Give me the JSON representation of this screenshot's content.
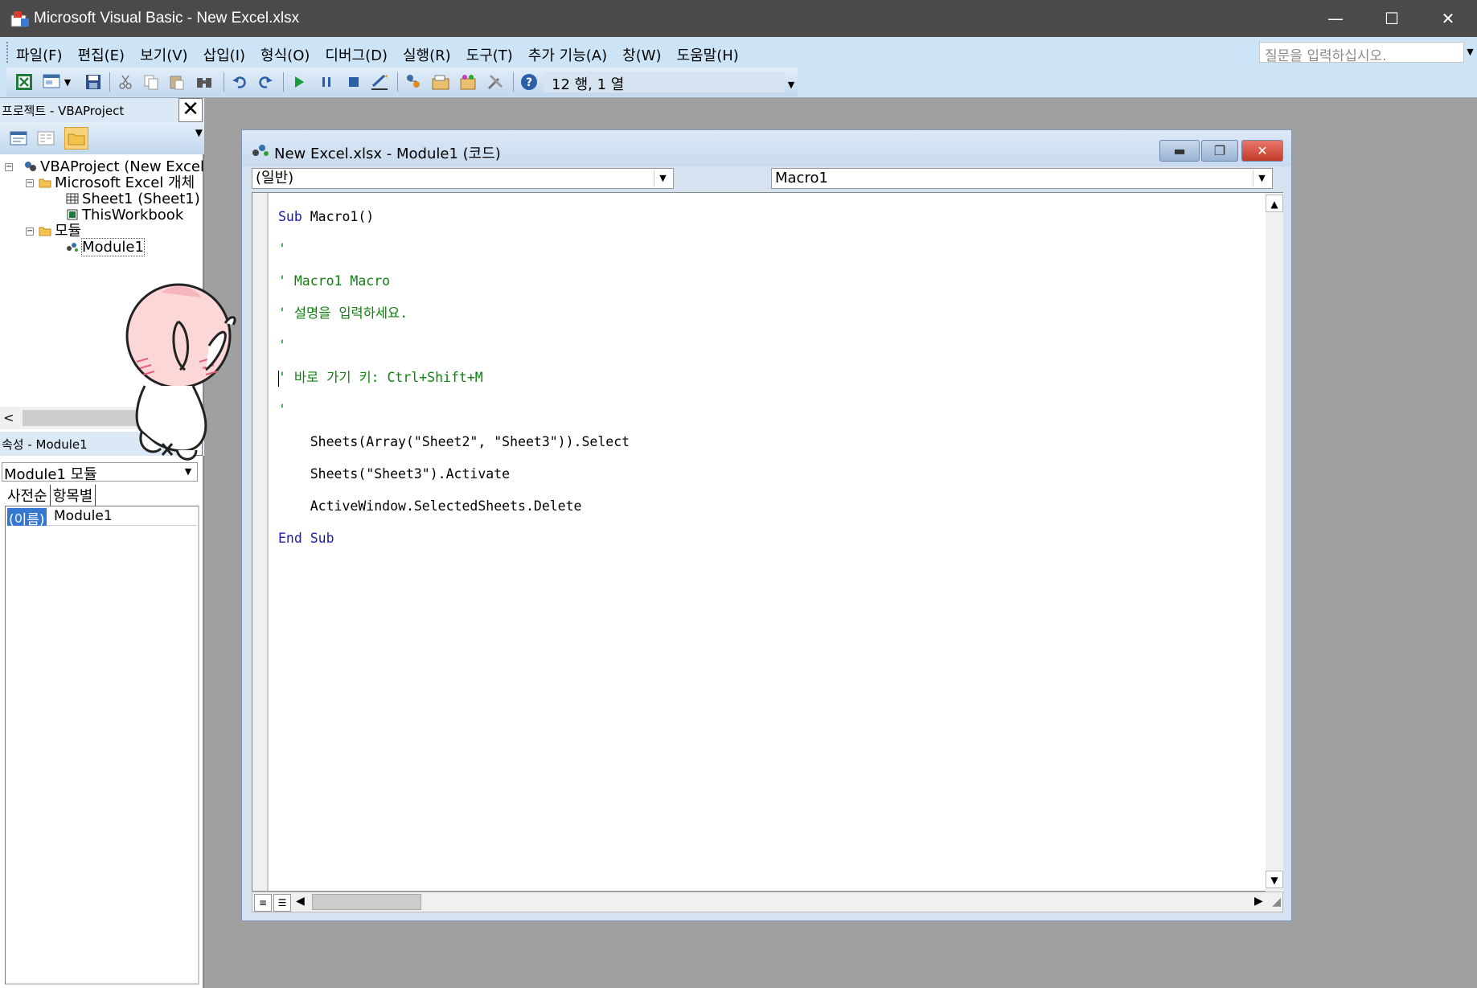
{
  "window": {
    "title": "Microsoft Visual Basic - New Excel.xlsx",
    "minimize_glyph": "—",
    "maximize_glyph": "☐",
    "close_glyph": "✕"
  },
  "menu": {
    "items": [
      "파일(F)",
      "편집(E)",
      "보기(V)",
      "삽입(I)",
      "형식(O)",
      "디버그(D)",
      "실행(R)",
      "도구(T)",
      "추가 기능(A)",
      "창(W)",
      "도움말(H)"
    ],
    "help_placeholder": "질문을 입력하십시오."
  },
  "toolbar": {
    "position": "12 행, 1 열",
    "icons": [
      "excel-icon",
      "insert-userform-icon",
      "save-icon",
      "cut-icon",
      "copy-icon",
      "paste-icon",
      "find-icon",
      "undo-icon",
      "redo-icon",
      "run-icon",
      "break-icon",
      "reset-icon",
      "design-mode-icon",
      "project-explorer-icon",
      "properties-window-icon",
      "object-browser-icon",
      "toolbox-icon",
      "help-icon"
    ]
  },
  "project_pane": {
    "title": "프로젝트 - VBAProject",
    "close": "✕",
    "tree": {
      "root": "VBAProject (New Excel.xlsx)",
      "excel_objects": "Microsoft Excel 개체",
      "sheet1": "Sheet1 (Sheet1)",
      "workbook": "ThisWorkbook",
      "modules": "모듈",
      "module1": "Module1"
    }
  },
  "props_pane": {
    "title": "속성 - Module1",
    "close": "✕",
    "object": "Module1 모듈",
    "tabs": [
      "사전순",
      "항목별"
    ],
    "rows": [
      {
        "key": "(이름)",
        "value": "Module1"
      }
    ]
  },
  "code_window": {
    "title": "New Excel.xlsx - Module1 (코드)",
    "object_combo": "(일반)",
    "proc_combo": "Macro1",
    "code": {
      "l1_kw": "Sub",
      "l1_rest": " Macro1()",
      "l2": "'",
      "l3": "' Macro1 Macro",
      "l4": "' 설명을 입력하세요.",
      "l5": "'",
      "l6": "' 바로 가기 키: Ctrl+Shift+M",
      "l7": "'",
      "l8": "    Sheets(Array(\"Sheet2\", \"Sheet3\")).Select",
      "l9": "    Sheets(\"Sheet3\").Activate",
      "l10": "    ActiveWindow.SelectedSheets.Delete",
      "l11_kw": "End Sub"
    }
  },
  "colors": {
    "menu_bg": "#cde4f7",
    "titlebar_bg": "#4a4a4a",
    "keyword": "#1b1bb0",
    "comment": "#108010",
    "selection": "#3478d0"
  }
}
